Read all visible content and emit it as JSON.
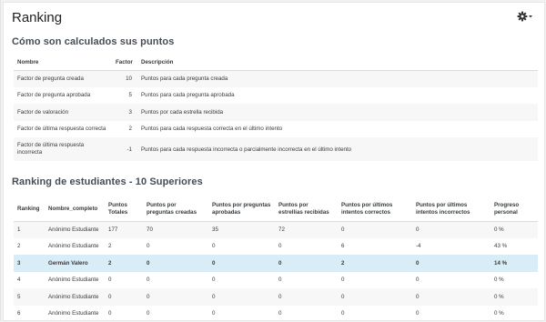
{
  "page": {
    "title": "Ranking"
  },
  "settings": {
    "icon": "gear-icon"
  },
  "points_section": {
    "heading": "Cómo son calculados sus puntos",
    "headers": {
      "name": "Nombre",
      "factor": "Factor",
      "description": "Descripción"
    },
    "rows": [
      {
        "name": "Factor de pregunta creada",
        "factor": "10",
        "description": "Puntos para cada pregunta creada"
      },
      {
        "name": "Factor de pregunta aprobada",
        "factor": "5",
        "description": "Puntos para cada pregunta aprobada"
      },
      {
        "name": "Factor de valoración",
        "factor": "3",
        "description": "Puntos por cada estrella recibida"
      },
      {
        "name": "Factor de última respuesta correcta",
        "factor": "2",
        "description": "Puntos para cada respuesta correcta en el último intento"
      },
      {
        "name": "Factor de última respuesta incorrecta",
        "factor": "-1",
        "description": "Puntos para cada respuesta incorrecta o parcialmente incorrecta en el último intento"
      }
    ]
  },
  "ranking_section": {
    "heading": "Ranking de estudiantes - 10 Superiores",
    "headers": {
      "rank": "Ranking",
      "name": "Nombre_completo",
      "total": "Puntos Totales",
      "created": "Puntos por preguntas creadas",
      "approved": "Puntos por preguntas aprobadas",
      "stars": "Puntos por estrellias recibidas",
      "correct": "Puntos por últimos intentos correctos",
      "incorrect": "Puntos por últimos intentos incorrectos",
      "progress": "Progreso personal"
    },
    "rows": [
      {
        "rank": "1",
        "name": "Anónimo Estudiante",
        "total": "177",
        "created": "70",
        "approved": "35",
        "stars": "72",
        "correct": "0",
        "incorrect": "0",
        "progress": "0 %"
      },
      {
        "rank": "2",
        "name": "Anónimo Estudiante",
        "total": "2",
        "created": "0",
        "approved": "0",
        "stars": "0",
        "correct": "6",
        "incorrect": "-4",
        "progress": "43 %"
      },
      {
        "rank": "3",
        "name": "Germán Valero",
        "total": "2",
        "created": "0",
        "approved": "0",
        "stars": "0",
        "correct": "2",
        "incorrect": "0",
        "progress": "14 %"
      },
      {
        "rank": "4",
        "name": "Anónimo Estudiante",
        "total": "0",
        "created": "0",
        "approved": "0",
        "stars": "0",
        "correct": "0",
        "incorrect": "0",
        "progress": "0 %"
      },
      {
        "rank": "5",
        "name": "Anónimo Estudiante",
        "total": "0",
        "created": "0",
        "approved": "0",
        "stars": "0",
        "correct": "0",
        "incorrect": "0",
        "progress": "0 %"
      },
      {
        "rank": "6",
        "name": "Anónimo Estudiante",
        "total": "0",
        "created": "0",
        "approved": "0",
        "stars": "0",
        "correct": "0",
        "incorrect": "0",
        "progress": "0 %"
      }
    ],
    "highlight_color": "#d9edf7"
  }
}
